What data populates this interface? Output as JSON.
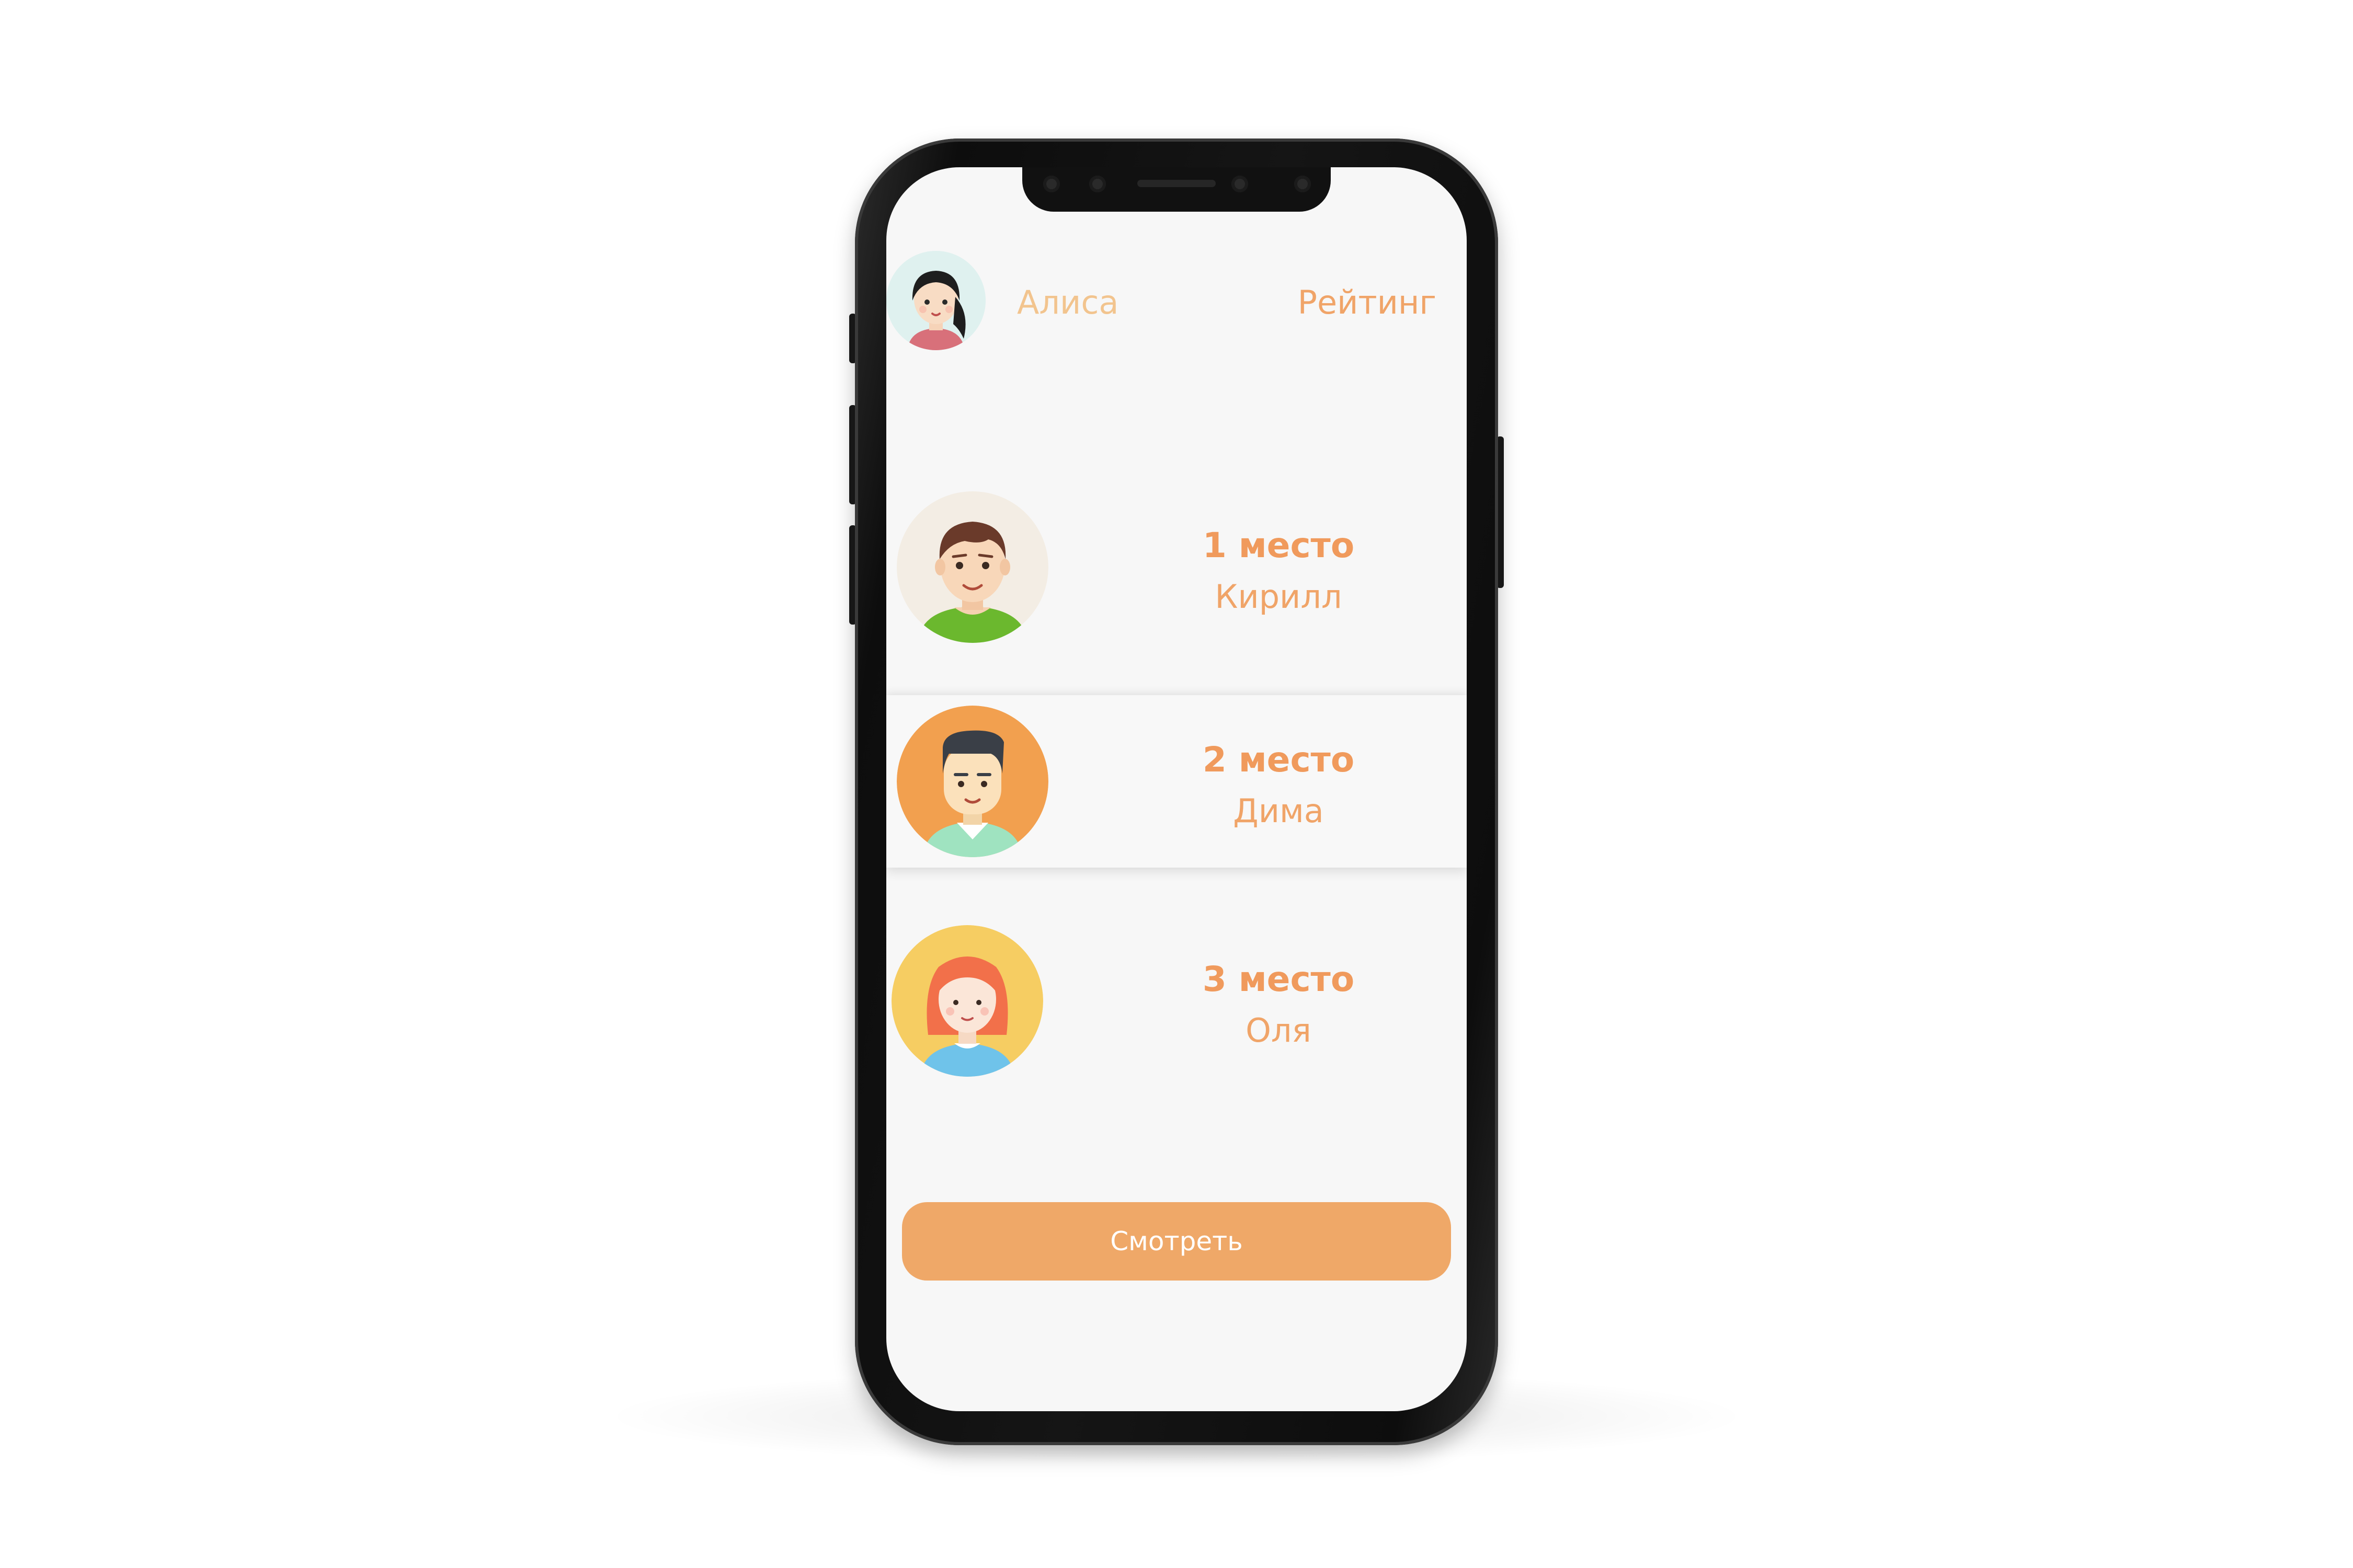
{
  "header": {
    "user_name": "Алиса",
    "section_title": "Рейтинг"
  },
  "ranking": [
    {
      "place": "1 место",
      "name": "Кирилл",
      "highlighted": false
    },
    {
      "place": "2 место",
      "name": "Дима",
      "highlighted": true
    },
    {
      "place": "3 место",
      "name": "Оля",
      "highlighted": false
    }
  ],
  "action": {
    "watch_label": "Смотреть"
  },
  "colors": {
    "accent": "#f09a5c",
    "button": "#efa868",
    "screen_bg": "#f7f7f7"
  }
}
